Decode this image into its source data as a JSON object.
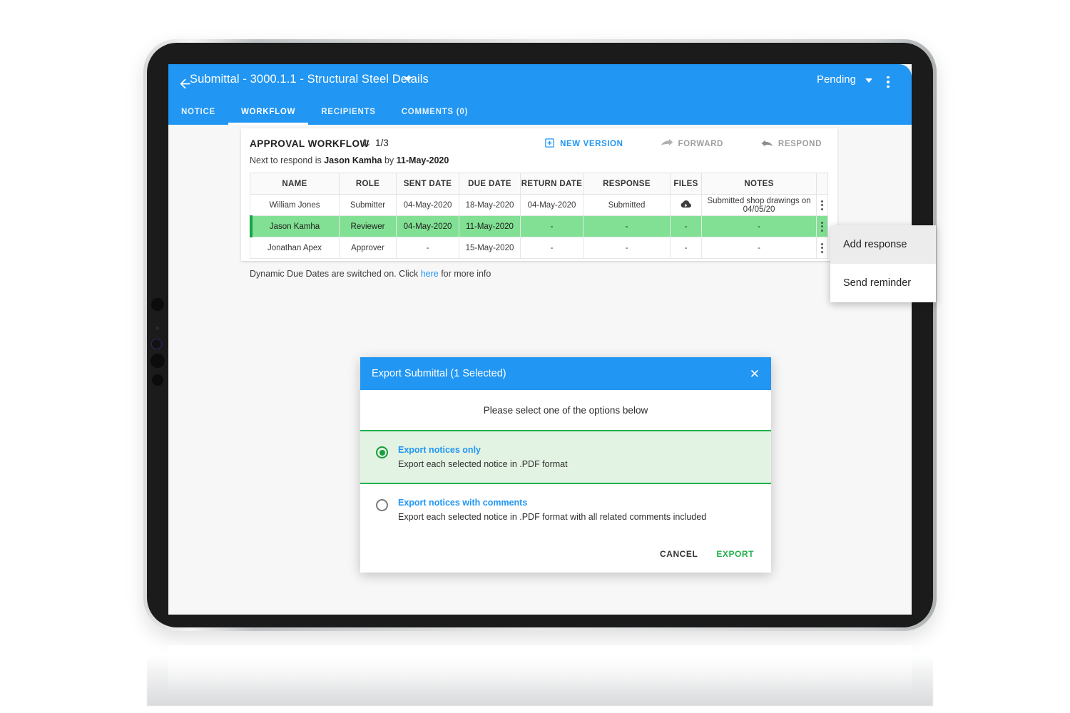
{
  "appbar": {
    "back_icon": "arrow-left-icon",
    "title": "Submittal - 3000.1.1 - Structural Steel Details",
    "title_caret_icon": "chevron-down-icon",
    "status": "Pending",
    "status_caret_icon": "chevron-down-icon",
    "overflow_icon": "kebab-vertical-icon",
    "accent_color": "#2196f3",
    "tabs": [
      {
        "label": "NOTICE",
        "active": false
      },
      {
        "label": "WORKFLOW",
        "active": true
      },
      {
        "label": "RECIPIENTS",
        "active": false
      },
      {
        "label": "COMMENTS (0)",
        "active": false
      }
    ]
  },
  "workflow": {
    "title": "APPROVAL WORKFLOW",
    "progress_icon": "person-check-icon",
    "progress": "1/3",
    "next_prefix": "Next to respond is ",
    "next_person": "Jason Kamha",
    "next_middle": " by ",
    "next_date": "11-May-2020",
    "actions": [
      {
        "label": "NEW VERSION",
        "icon": "add-box-icon",
        "state": "enabled",
        "color": "#2196f3"
      },
      {
        "label": "FORWARD",
        "icon": "forward-arrow-icon",
        "state": "disabled",
        "color": "#9e9e9e"
      },
      {
        "label": "RESPOND",
        "icon": "reply-arrow-icon",
        "state": "disabled",
        "color": "#9e9e9e"
      }
    ],
    "columns": [
      "NAME",
      "ROLE",
      "SENT DATE",
      "DUE DATE",
      "RETURN DATE",
      "RESPONSE",
      "FILES",
      "NOTES"
    ],
    "rows": [
      {
        "name": "William Jones",
        "role": "Submitter",
        "sent_date": "04-May-2020",
        "due_date": "18-May-2020",
        "return_date": "04-May-2020",
        "response": "Submitted",
        "files": "cloud-download-icon",
        "notes": "Submitted shop drawings on 04/05/20",
        "highlighted": false,
        "row_menu_icon": "kebab-vertical-icon"
      },
      {
        "name": "Jason Kamha",
        "role": "Reviewer",
        "sent_date": "04-May-2020",
        "due_date": "11-May-2020",
        "return_date": "-",
        "response": "-",
        "files": "-",
        "notes": "-",
        "highlighted": true,
        "row_menu_icon": "kebab-vertical-icon"
      },
      {
        "name": "Jonathan Apex",
        "role": "Approver",
        "sent_date": "-",
        "due_date": "15-May-2020",
        "return_date": "-",
        "response": "-",
        "files": "-",
        "notes": "-",
        "highlighted": false,
        "row_menu_icon": "kebab-vertical-icon"
      }
    ],
    "footnote_pre": "Dynamic Due Dates are switched on. Click ",
    "footnote_link": "here",
    "footnote_post": " for more info",
    "highlight_color": "#81e093",
    "highlight_border_color": "#16a34a"
  },
  "row_menu": {
    "items": [
      {
        "label": "Add response",
        "hovered": true
      },
      {
        "label": "Send reminder",
        "hovered": false
      }
    ]
  },
  "export_dialog": {
    "title": "Export Submittal (1 Selected)",
    "close_icon": "close-icon",
    "prompt": "Please select one of the options below",
    "options": [
      {
        "title": "Export notices only",
        "description": "Export each selected notice in .PDF format",
        "selected": true
      },
      {
        "title": "Export notices with comments",
        "description": "Export each selected notice in .PDF format with all related comments included",
        "selected": false
      }
    ],
    "cancel_label": "CANCEL",
    "export_label": "EXPORT",
    "selected_bg_color": "#e3f3e3",
    "selected_border_color": "#22b14c",
    "export_button_color": "#22b14c"
  }
}
